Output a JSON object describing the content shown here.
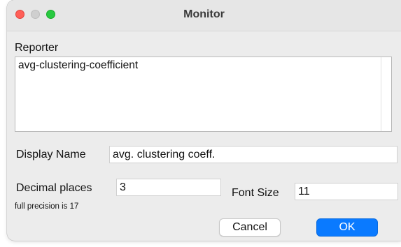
{
  "window": {
    "title": "Monitor"
  },
  "reporter": {
    "label": "Reporter",
    "value": "avg-clustering-coefficient"
  },
  "display_name": {
    "label": "Display Name",
    "value": "avg. clustering coeff."
  },
  "decimal_places": {
    "label": "Decimal places",
    "value": "3",
    "hint": "full precision is 17"
  },
  "font_size": {
    "label": "Font Size",
    "value": "11"
  },
  "buttons": {
    "cancel_label": "Cancel",
    "ok_label": "OK"
  },
  "colors": {
    "accent": "#0a7aff",
    "close": "#ff5f57",
    "minimize": "#cfcfcf",
    "maximize": "#28c940"
  }
}
